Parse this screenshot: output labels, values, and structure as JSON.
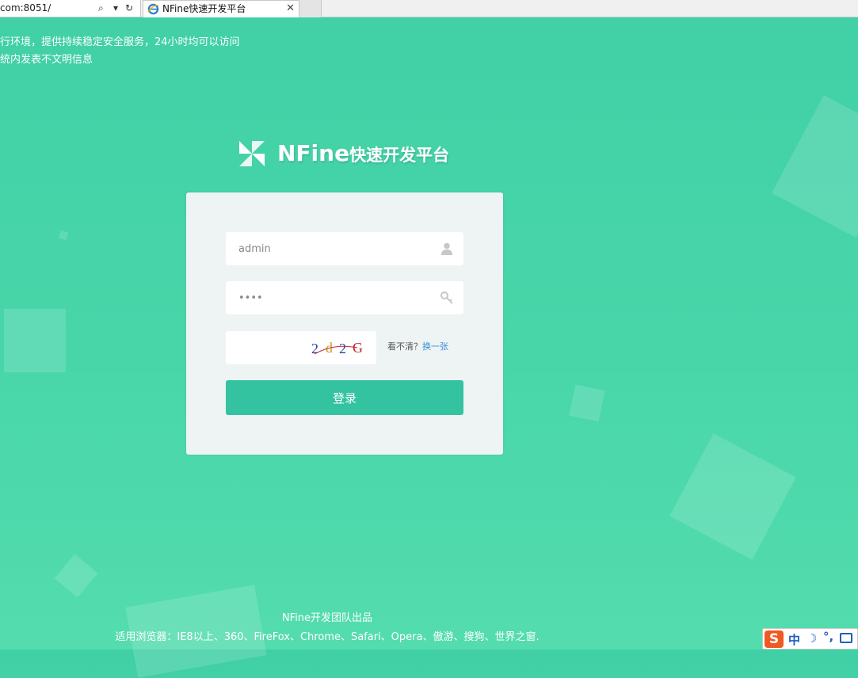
{
  "browser": {
    "url": "com:8051/",
    "search_icon": "search-icon",
    "dropdown_icon": "chevron-down-icon",
    "refresh_icon": "refresh-icon",
    "tab_title": "NFine快速开发平台",
    "tab_close": "✕",
    "refresh_glyph": "↻",
    "search_glyph": "⌕",
    "dropdown_glyph": "▾"
  },
  "notice": {
    "line1": "行环境，提供持续稳定安全服务，24小时均可以访问",
    "line2": "统内发表不文明信息"
  },
  "logo": {
    "brand_en": "NFine",
    "brand_cn": "快速开发平台"
  },
  "login": {
    "username_value": "admin",
    "password_value": "••••",
    "captcha_value": "",
    "captcha_text": "2d2G",
    "refresh_prompt": "看不清？",
    "refresh_link": "换一张",
    "submit_label": "登录"
  },
  "footer": {
    "line1": "NFine开发团队出品",
    "line2": "适用浏览器：IE8以上、360、FireFox、Chrome、Safari、Opera、傲游、搜狗、世界之窗."
  },
  "ime": {
    "logo": "S",
    "mode": "中",
    "moon": "☽",
    "punct": "°,"
  },
  "colors": {
    "background": "#48d6a9",
    "button": "#34c3a0",
    "panel": "#eef3f3",
    "link": "#3a8fd8"
  }
}
